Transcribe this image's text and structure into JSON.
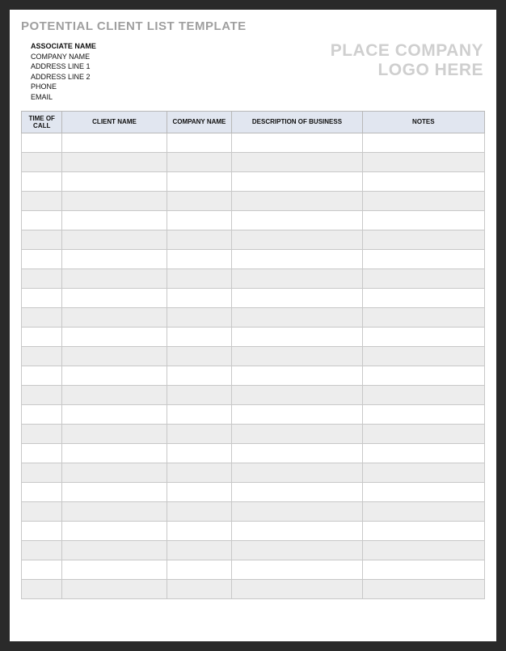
{
  "title": "POTENTIAL CLIENT LIST TEMPLATE",
  "associate": {
    "name": "ASSOCIATE NAME",
    "company": "COMPANY NAME",
    "address1": "ADDRESS LINE 1",
    "address2": "ADDRESS LINE 2",
    "phone": "PHONE",
    "email": "EMAIL"
  },
  "logo": {
    "line1": "PLACE COMPANY",
    "line2": "LOGO HERE"
  },
  "columns": {
    "time": "TIME OF CALL",
    "client": "CLIENT NAME",
    "company": "COMPANY NAME",
    "desc": "DESCRIPTION OF BUSINESS",
    "notes": "NOTES"
  },
  "rows": [
    {
      "time": "",
      "client": "",
      "company": "",
      "desc": "",
      "notes": ""
    },
    {
      "time": "",
      "client": "",
      "company": "",
      "desc": "",
      "notes": ""
    },
    {
      "time": "",
      "client": "",
      "company": "",
      "desc": "",
      "notes": ""
    },
    {
      "time": "",
      "client": "",
      "company": "",
      "desc": "",
      "notes": ""
    },
    {
      "time": "",
      "client": "",
      "company": "",
      "desc": "",
      "notes": ""
    },
    {
      "time": "",
      "client": "",
      "company": "",
      "desc": "",
      "notes": ""
    },
    {
      "time": "",
      "client": "",
      "company": "",
      "desc": "",
      "notes": ""
    },
    {
      "time": "",
      "client": "",
      "company": "",
      "desc": "",
      "notes": ""
    },
    {
      "time": "",
      "client": "",
      "company": "",
      "desc": "",
      "notes": ""
    },
    {
      "time": "",
      "client": "",
      "company": "",
      "desc": "",
      "notes": ""
    },
    {
      "time": "",
      "client": "",
      "company": "",
      "desc": "",
      "notes": ""
    },
    {
      "time": "",
      "client": "",
      "company": "",
      "desc": "",
      "notes": ""
    },
    {
      "time": "",
      "client": "",
      "company": "",
      "desc": "",
      "notes": ""
    },
    {
      "time": "",
      "client": "",
      "company": "",
      "desc": "",
      "notes": ""
    },
    {
      "time": "",
      "client": "",
      "company": "",
      "desc": "",
      "notes": ""
    },
    {
      "time": "",
      "client": "",
      "company": "",
      "desc": "",
      "notes": ""
    },
    {
      "time": "",
      "client": "",
      "company": "",
      "desc": "",
      "notes": ""
    },
    {
      "time": "",
      "client": "",
      "company": "",
      "desc": "",
      "notes": ""
    },
    {
      "time": "",
      "client": "",
      "company": "",
      "desc": "",
      "notes": ""
    },
    {
      "time": "",
      "client": "",
      "company": "",
      "desc": "",
      "notes": ""
    },
    {
      "time": "",
      "client": "",
      "company": "",
      "desc": "",
      "notes": ""
    },
    {
      "time": "",
      "client": "",
      "company": "",
      "desc": "",
      "notes": ""
    },
    {
      "time": "",
      "client": "",
      "company": "",
      "desc": "",
      "notes": ""
    },
    {
      "time": "",
      "client": "",
      "company": "",
      "desc": "",
      "notes": ""
    }
  ]
}
